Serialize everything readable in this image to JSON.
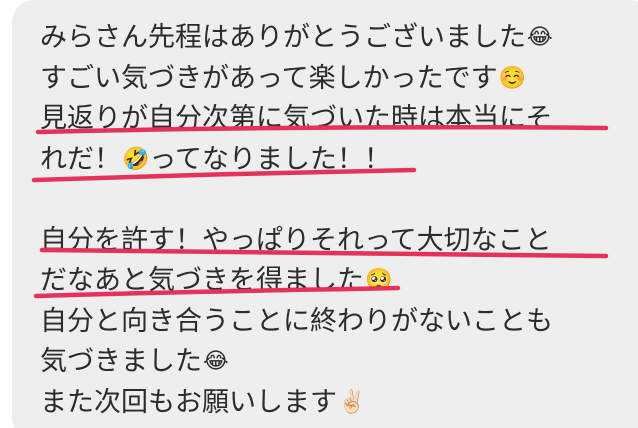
{
  "message": {
    "lines": [
      {
        "text": "みらさん先程はありがとうございました",
        "emoji": "😂"
      },
      {
        "text": "すごい気づきがあって楽しかったです",
        "emoji": "☺️"
      },
      {
        "text": "見返りが自分次第に気づいた時は本当にそ",
        "emoji": ""
      },
      {
        "text": "れだ！",
        "emoji": "🤣",
        "text2": "ってなりました！！"
      },
      {
        "text": "自分を許す！やっぱりそれって大切なこと",
        "emoji": ""
      },
      {
        "text": "だなあと気づきを得ました",
        "emoji": "🥺"
      },
      {
        "text": "自分と向き合うことに終わりがないことも",
        "emoji": ""
      },
      {
        "text": "気づきました",
        "emoji": "😂"
      },
      {
        "text": "また次回もお願いします",
        "emoji": "✌🏻"
      }
    ]
  },
  "colors": {
    "bubble": "#eeeeef",
    "text": "#2b2b2b",
    "underline": "#e5325b"
  }
}
